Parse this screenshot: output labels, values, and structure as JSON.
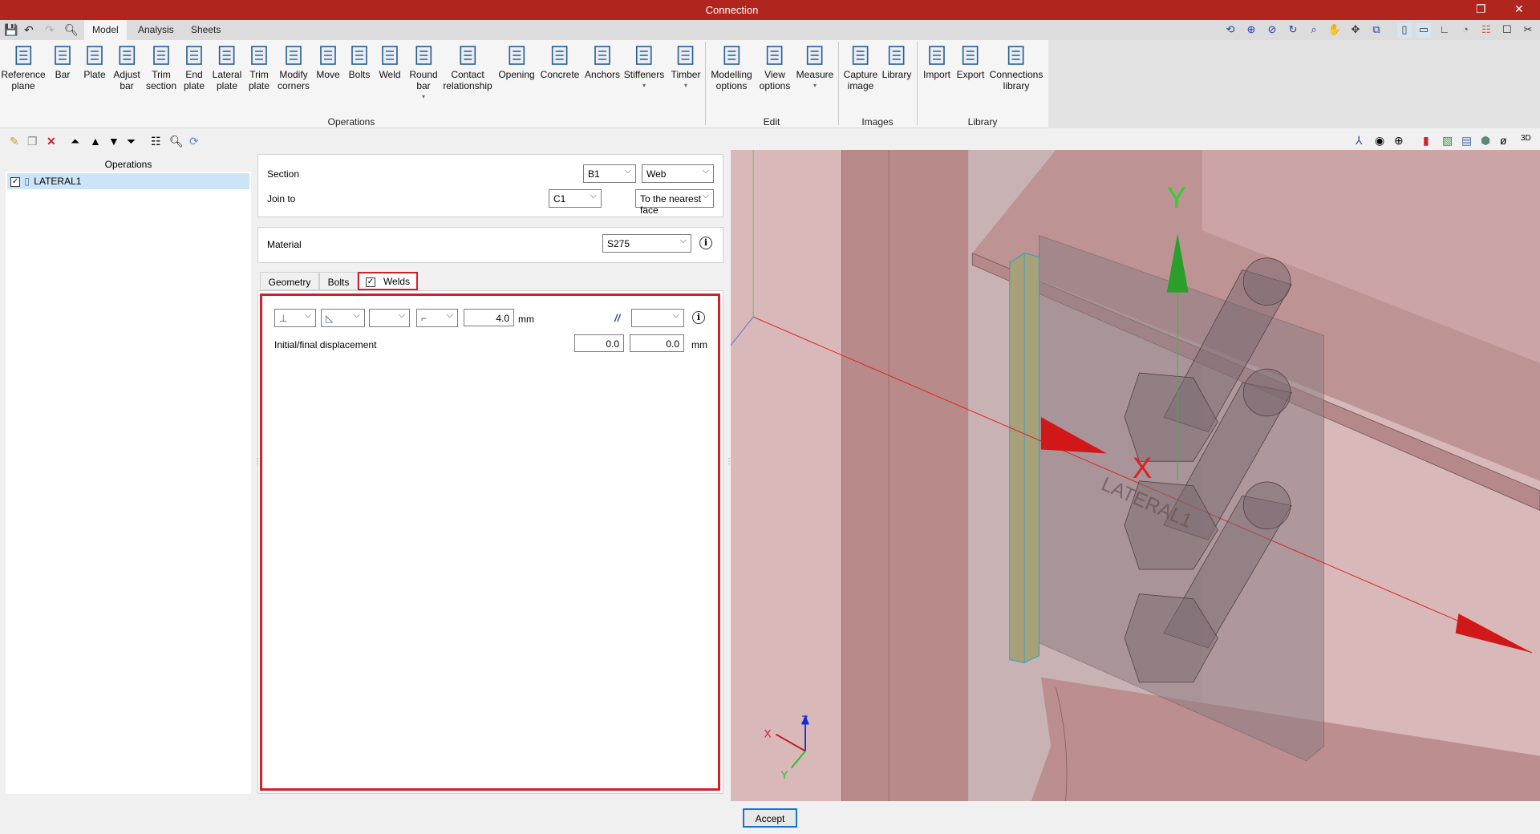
{
  "window": {
    "title": "Connection",
    "restore_icon": "restore-icon",
    "close_icon": "close-icon"
  },
  "menu_tabs": [
    "Model",
    "Analysis",
    "Sheets"
  ],
  "active_tab": "Model",
  "ribbon": {
    "groups": [
      "Operations",
      "Edit",
      "Images",
      "Library"
    ],
    "items": [
      {
        "label": "Reference\nplane",
        "icon": "grid-icon",
        "group": "Operations"
      },
      {
        "label": "Bar",
        "icon": "i-beam-icon",
        "group": "Operations"
      },
      {
        "label": "Plate",
        "icon": "plate-icon",
        "group": "Operations"
      },
      {
        "label": "Adjust\nbar",
        "icon": "adjust-bar-icon",
        "group": "Operations"
      },
      {
        "label": "Trim\nsection",
        "icon": "trim-section-icon",
        "group": "Operations"
      },
      {
        "label": "End\nplate",
        "icon": "end-plate-icon",
        "group": "Operations"
      },
      {
        "label": "Lateral\nplate",
        "icon": "lateral-plate-icon",
        "group": "Operations"
      },
      {
        "label": "Trim\nplate",
        "icon": "trim-plate-icon",
        "group": "Operations"
      },
      {
        "label": "Modify\ncorners",
        "icon": "modify-corners-icon",
        "group": "Operations"
      },
      {
        "label": "Move",
        "icon": "move-icon",
        "group": "Operations"
      },
      {
        "label": "Bolts",
        "icon": "bolt-icon",
        "group": "Operations"
      },
      {
        "label": "Weld",
        "icon": "weld-icon",
        "group": "Operations"
      },
      {
        "label": "Round\nbar",
        "icon": "round-bar-icon",
        "group": "Operations",
        "dropdown": true
      },
      {
        "label": "Contact\nrelationship",
        "icon": "contact-icon",
        "group": "Operations"
      },
      {
        "label": "Opening",
        "icon": "opening-icon",
        "group": "Operations"
      },
      {
        "label": "Concrete",
        "icon": "concrete-cube-icon",
        "group": "Operations"
      },
      {
        "label": "Anchors",
        "icon": "anchor-icon",
        "group": "Operations"
      },
      {
        "label": "Stiffeners",
        "icon": "stiffener-icon",
        "group": "Operations",
        "dropdown": true
      },
      {
        "label": "Timber",
        "icon": "screw-icon",
        "group": "Operations",
        "dropdown": true
      },
      {
        "label": "Modelling\noptions",
        "icon": "modelling-options-icon",
        "group": "Edit"
      },
      {
        "label": "View\noptions",
        "icon": "eye-icon",
        "group": "Edit"
      },
      {
        "label": "Measure",
        "icon": "ruler-icon",
        "group": "Edit",
        "dropdown": true
      },
      {
        "label": "Capture\nimage",
        "icon": "camera-icon",
        "group": "Images"
      },
      {
        "label": "Library",
        "icon": "image-library-icon",
        "group": "Images"
      },
      {
        "label": "Import",
        "icon": "import-icon",
        "group": "Library"
      },
      {
        "label": "Export",
        "icon": "export-icon",
        "group": "Library"
      },
      {
        "label": "Connections\nlibrary",
        "icon": "connections-library-icon",
        "group": "Library"
      }
    ]
  },
  "operations_panel": {
    "header": "Operations",
    "items": [
      {
        "label": "LATERAL1",
        "checked": true,
        "selected": true
      }
    ]
  },
  "section": {
    "label": "Section",
    "value": "B1",
    "part": "Web"
  },
  "join_to": {
    "label": "Join to",
    "value": "C1",
    "mode": "To the nearest face"
  },
  "material": {
    "label": "Material",
    "value": "S275"
  },
  "tabs": [
    {
      "label": "Geometry"
    },
    {
      "label": "Bolts"
    },
    {
      "label": "Welds",
      "checked": true,
      "active": true
    }
  ],
  "welds": {
    "thickness": "4.0",
    "unit": "mm",
    "extra_select": "",
    "displacement_label": "Initial/final displacement",
    "initial": "0.0",
    "final": "0.0",
    "displacement_unit": "mm"
  },
  "view3d": {
    "axis_x": "X",
    "axis_y": "Y",
    "element_label": "LATERAL1",
    "triad": {
      "x": "X",
      "y": "Y",
      "z": "Z"
    }
  },
  "accept_label": "Accept",
  "colors": {
    "title_bar": "#b0261e",
    "highlight": "#d0202a",
    "selection": "#cce4f7"
  }
}
